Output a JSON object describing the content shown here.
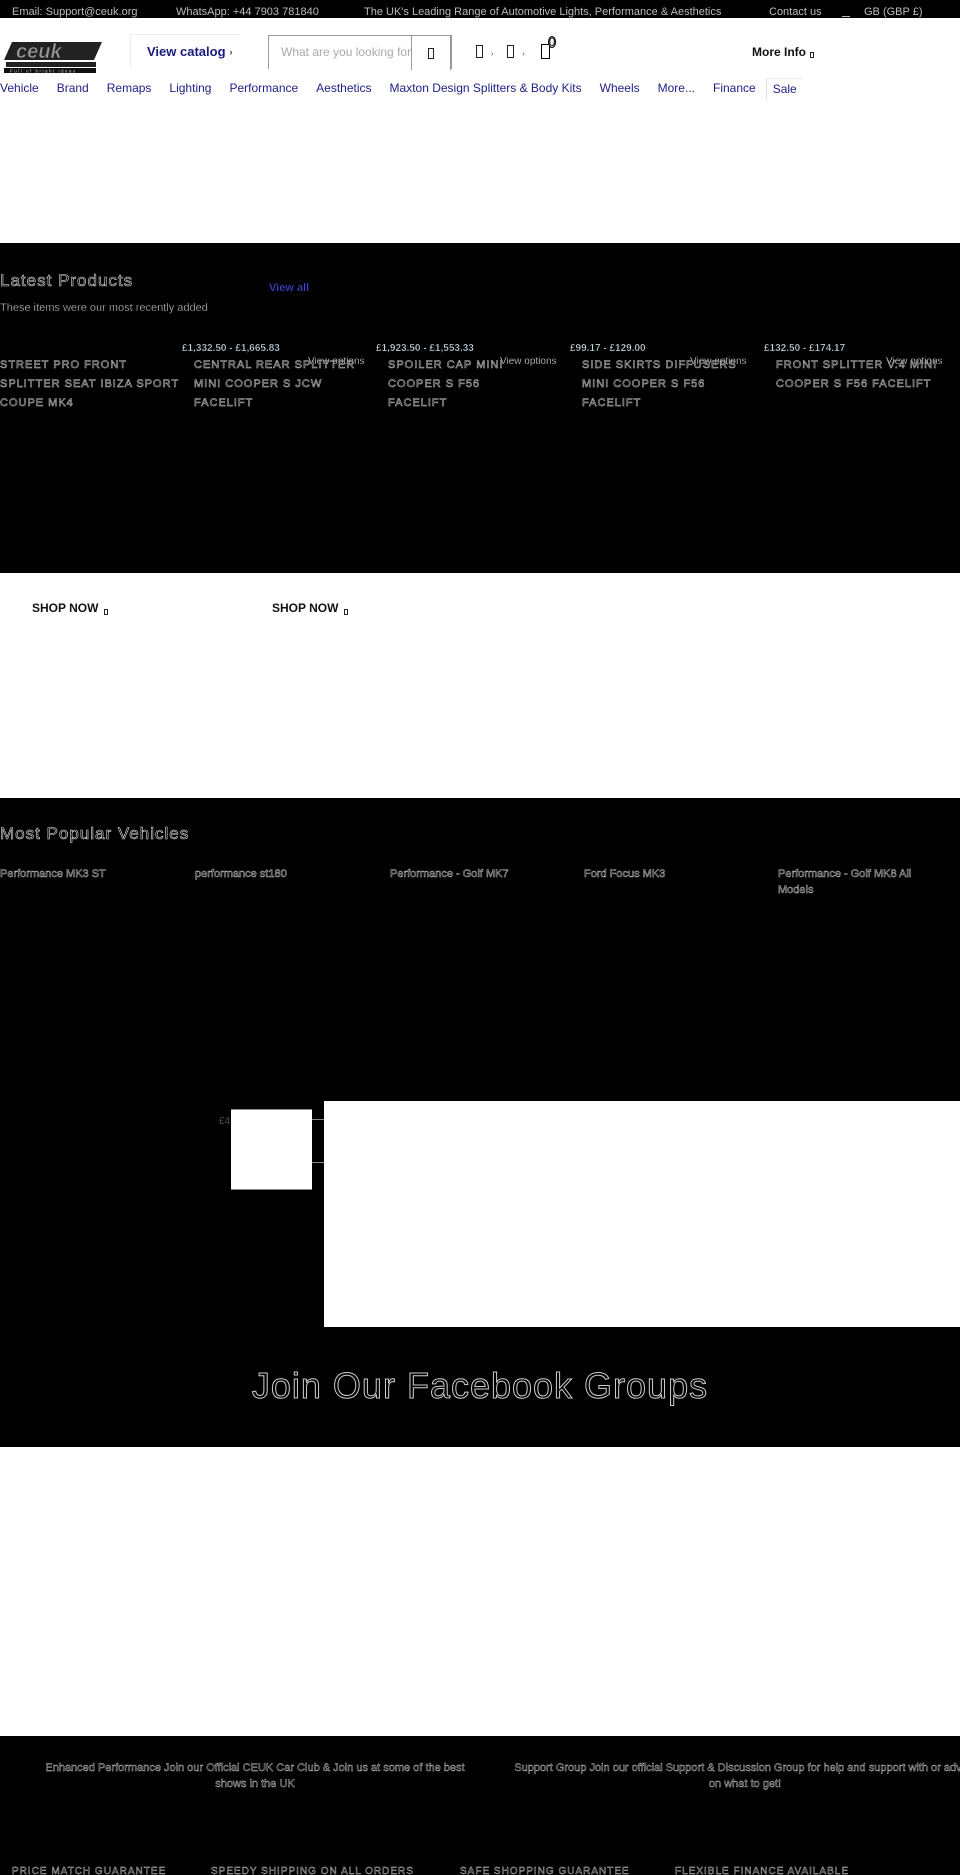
{
  "topbar": {
    "email": "Email: Support@ceuk.org",
    "whatsapp": "WhatsApp: +44 7903 781840",
    "tagline": "The UK's Leading Range of Automotive Lights, Performance & Aesthetics",
    "contact": "Contact us",
    "currency": "GB (GBP £)"
  },
  "header": {
    "logo_alt": "ceuk car enhancements UK - Full of bright ideas",
    "view_catalog": "View catalog",
    "catalog_chevron": "›",
    "search_placeholder": "What are you looking for",
    "search_icon": "search-icon",
    "account_icon": "account-icon",
    "wishlist_icon": "wishlist-icon",
    "cart_icon": "cart-icon",
    "cart_count": "0",
    "more_info": "More Info"
  },
  "nav": {
    "items": [
      "Vehicle",
      "Brand",
      "Remaps",
      "Lighting",
      "Performance",
      "Aesthetics",
      "Maxton Design Splitters & Body Kits",
      "Wheels",
      "More...",
      "Finance",
      "Sale"
    ]
  },
  "latest": {
    "title": "Latest Products",
    "view_all": "View all",
    "subtitle": "These items were our most recently added",
    "products": [
      {
        "price": "",
        "name": "STREET PRO FRONT SPLITTER SEAT IBIZA SPORT COUPE MK4",
        "options": ""
      },
      {
        "price": "£1,332.50 - £1,665.83",
        "name": "CENTRAL REAR SPLITTER MINI COOPER S JCW FACELIFT",
        "options": "View options"
      },
      {
        "price": "£1,923.50 - £1,553.33",
        "name": "SPOILER CAP MINI COOPER S F56 FACELIFT",
        "options": "View options"
      },
      {
        "price": "£99.17 - £129.00",
        "name": "SIDE SKIRTS DIFFUSERS MINI COOPER S F56 FACELIFT",
        "options": "View options"
      },
      {
        "price": "£132.50 - £174.17",
        "name": "FRONT SPLITTER V.4 MINI COOPER S F56 FACELIFT",
        "options": "View options"
      }
    ]
  },
  "promo": {
    "shop_now_1": "SHOP NOW",
    "shop_now_2": "SHOP NOW"
  },
  "popular": {
    "title": "Most Popular Vehicles",
    "vehicles": [
      "Performance MK3 ST",
      "performance st180",
      "Performance - Golf MK7",
      "Ford Focus MK3",
      "Performance - Golf MK8 All Models"
    ]
  },
  "mid": {
    "price_fragment": "£4"
  },
  "facebook": {
    "title": "Join Our Facebook Groups",
    "groups": [
      {
        "text": "Enhanced Performance Join our Official CEUK Car Club & Join us at some of the best shows in the UK"
      },
      {
        "text": "Support Group Join our official Support & Discussion Group for help and support with or advice on what to get!"
      }
    ]
  },
  "usps": [
    "PRICE MATCH GUARANTEE",
    "SPEEDY SHIPPING ON ALL ORDERS",
    "SAFE SHOPPING GUARANTEE",
    "FLEXIBLE FINANCE AVAILABLE"
  ]
}
